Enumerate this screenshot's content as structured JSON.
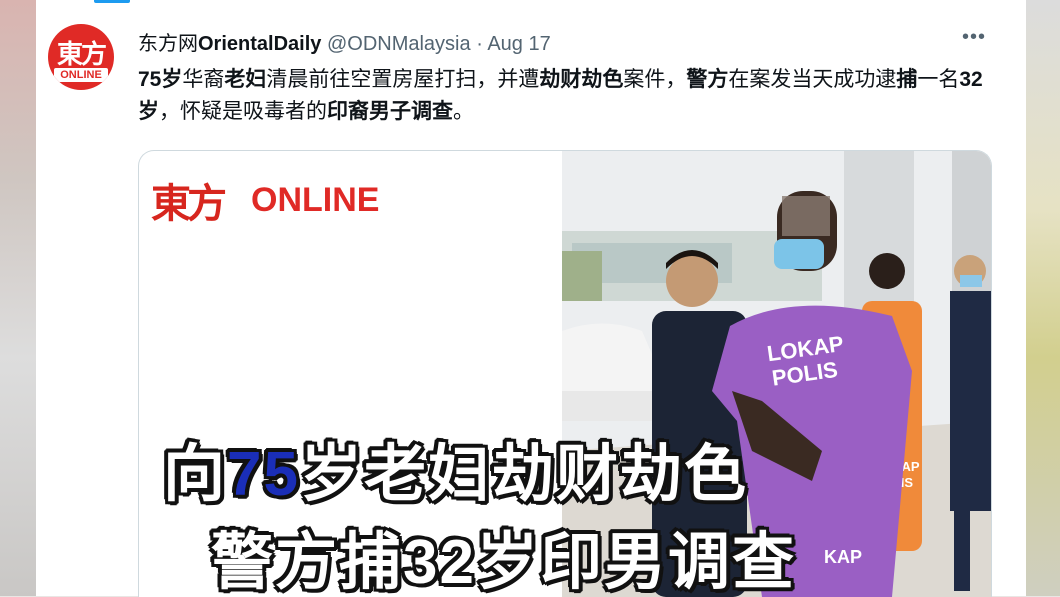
{
  "tweet": {
    "display_name_prefix": "东方网",
    "display_name_bold": "OrientalDaily",
    "handle": "@ODNMalaysia",
    "separator": "·",
    "date": "Aug 17",
    "more_label": "•••",
    "text_segments": [
      {
        "t": "75岁",
        "b": true
      },
      {
        "t": "华裔",
        "b": false
      },
      {
        "t": "老妇",
        "b": true
      },
      {
        "t": "清晨前往空置房屋打扫，并遭",
        "b": false
      },
      {
        "t": "劫财劫色",
        "b": true
      },
      {
        "t": "案件，",
        "b": false
      },
      {
        "t": "警方",
        "b": true
      },
      {
        "t": "在案发当天成功逮",
        "b": false
      },
      {
        "t": "捕",
        "b": true
      },
      {
        "t": "一名",
        "b": false
      },
      {
        "t": "32岁",
        "b": true
      },
      {
        "t": "，怀疑是吸毒者的",
        "b": false
      },
      {
        "t": "印裔男子调查",
        "b": true
      },
      {
        "t": "。",
        "b": false
      }
    ]
  },
  "avatar": {
    "mark_text": "東方",
    "sub_text": "ONLINE"
  },
  "media": {
    "logo_mark": "東方",
    "logo_online": "ONLINE",
    "headline_line1": [
      "向",
      "75",
      "岁老妇劫财劫色"
    ],
    "headline_line2": "警方捕32岁印男调查",
    "shirt_text_1": "LOKAP",
    "shirt_text_2": "POLIS",
    "shirt_text_small_1": "LOKAP",
    "shirt_text_small_2": "POLIS",
    "shirt_bottom_text": "KAP"
  },
  "colors": {
    "twitter_blue": "#1d9bf0",
    "brand_red": "#e02a26",
    "headline_blue": "#1a2eb8",
    "lokap_purple": "#9a5fc4",
    "lokap_orange": "#f08a3a"
  }
}
